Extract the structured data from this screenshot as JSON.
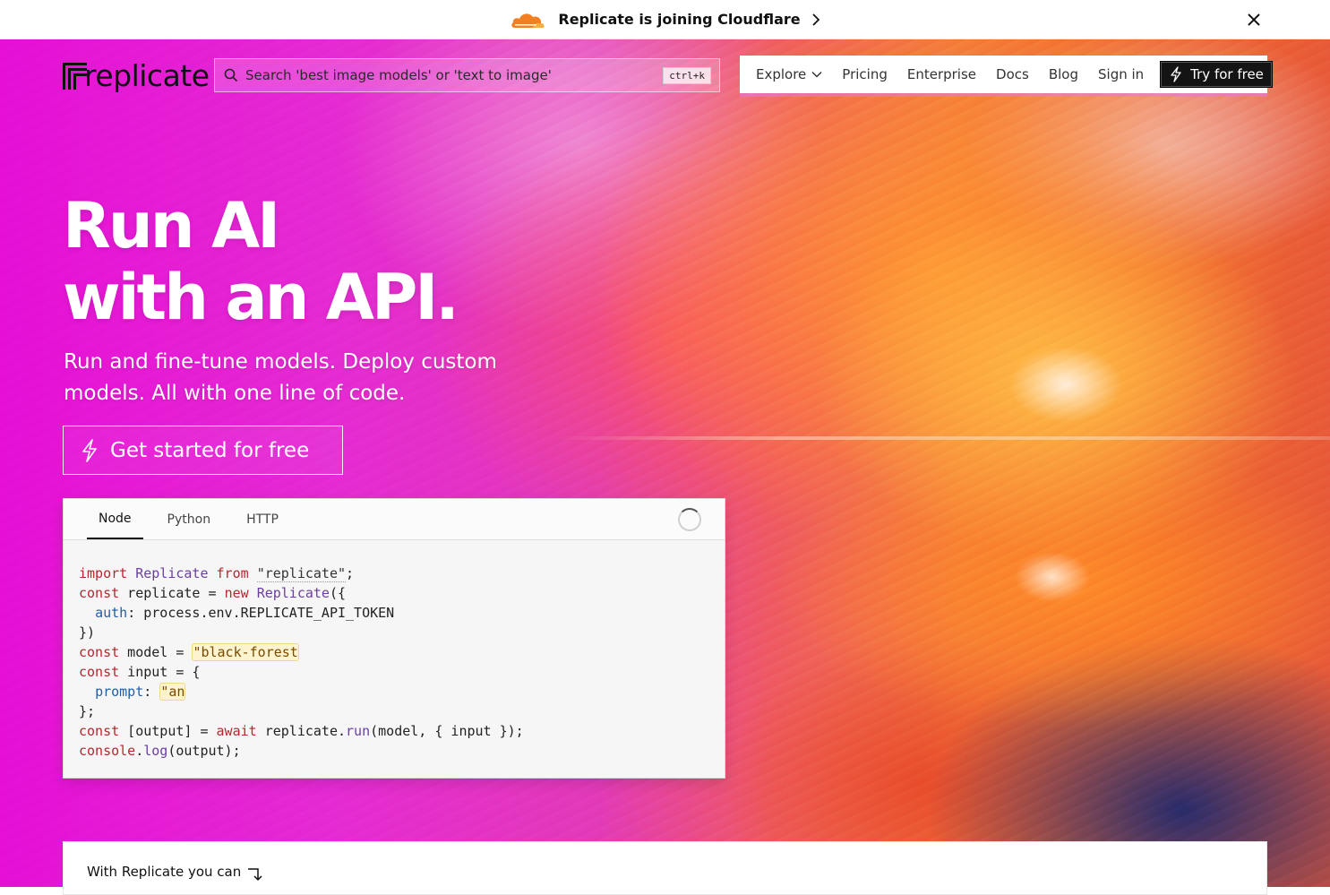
{
  "announcement": {
    "text": "Replicate is joining Cloudflare",
    "icon": "cloudflare-logo-icon",
    "accent_color": "#f38020"
  },
  "header": {
    "logo_text": "replicate",
    "search": {
      "placeholder": "Search 'best image models' or 'text to image'",
      "shortcut": "ctrl+k"
    },
    "nav": {
      "explore": "Explore",
      "pricing": "Pricing",
      "enterprise": "Enterprise",
      "docs": "Docs",
      "blog": "Blog",
      "sign_in": "Sign in",
      "try_free": "Try for free"
    }
  },
  "hero": {
    "headline_line1": "Run AI",
    "headline_line2": "with an API.",
    "subhead": "Run and fine-tune models. Deploy custom models. All with one line of code.",
    "cta": "Get started for free"
  },
  "code_panel": {
    "tabs": [
      "Node",
      "Python",
      "HTTP"
    ],
    "active_tab": "Node",
    "lines": {
      "l1_kw": "import",
      "l1_cls": "Replicate",
      "l1_kw2": "from",
      "l1_str": "\"replicate\"",
      "l1_end": ";",
      "l2_kw": "const",
      "l2_mid": " replicate = ",
      "l2_kw2": "new",
      "l2_cls": "Replicate",
      "l2_end": "({",
      "l3_prop": "auth",
      "l3_rest": ": process.env.REPLICATE_API_TOKEN",
      "l4": "})",
      "l5_kw": "const",
      "l5_mid": " model = ",
      "l5_str": "\"black-forest",
      "l6_kw": "const",
      "l6_mid": " input = {",
      "l7_prop": "prompt",
      "l7_mid": ": ",
      "l7_str": "\"an",
      "l8": "};",
      "l9_kw": "const",
      "l9_mid": " [output] = ",
      "l9_kw2": "await",
      "l9_mid2": " replicate.",
      "l9_fn": "run",
      "l9_end": "(model, { input });",
      "l10_kw": "console",
      "l10_dot": ".",
      "l10_fn": "log",
      "l10_end": "(output);"
    }
  },
  "bottom_card": {
    "label": "With Replicate you can"
  }
}
